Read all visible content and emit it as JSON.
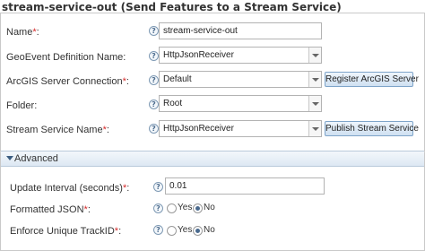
{
  "title": "stream-service-out (Send Features to a Stream Service)",
  "help_glyph": "?",
  "fields": {
    "name": {
      "label": "Name",
      "required": "*",
      "suffix": ":",
      "value": "stream-service-out"
    },
    "definition": {
      "label": "GeoEvent Definition Name",
      "suffix": ":",
      "value": "HttpJsonReceiver"
    },
    "connection": {
      "label": "ArcGIS Server Connection",
      "required": "*",
      "suffix": ":",
      "value": "Default",
      "button": "Register ArcGIS Server"
    },
    "folder": {
      "label": "Folder",
      "suffix": ":",
      "value": "Root"
    },
    "stream_service": {
      "label": "Stream Service Name",
      "required": "*",
      "suffix": ":",
      "value": "HttpJsonReceiver",
      "button": "Publish Stream Service"
    }
  },
  "advanced": {
    "header": "Advanced",
    "update_interval": {
      "label": "Update Interval (seconds)",
      "required": "*",
      "suffix": ":",
      "value": "0.01"
    },
    "formatted_json": {
      "label": "Formatted JSON",
      "required": "*",
      "suffix": ":",
      "options": [
        "Yes",
        "No"
      ],
      "selected": "No"
    },
    "enforce_track": {
      "label": "Enforce Unique TrackID",
      "required": "*",
      "suffix": ":",
      "options": [
        "Yes",
        "No"
      ],
      "selected": "No"
    }
  }
}
